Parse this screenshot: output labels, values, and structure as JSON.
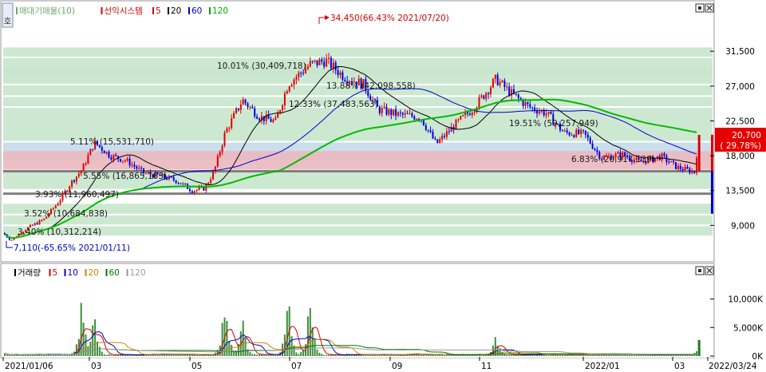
{
  "legend_price": {
    "items": [
      {
        "text": "매대기매물(10)",
        "color": "#6aa86a"
      },
      {
        "text": "선익시스템",
        "color": "#d40000"
      },
      {
        "text": "5",
        "color": "#d40000"
      },
      {
        "text": "20",
        "color": "#000000"
      },
      {
        "text": "60",
        "color": "#0000cc"
      },
      {
        "text": "120",
        "color": "#00aa00"
      }
    ]
  },
  "legend_volume": {
    "items": [
      {
        "text": "거래량",
        "color": "#000000"
      },
      {
        "text": "5",
        "color": "#d40000"
      },
      {
        "text": "10",
        "color": "#0000cc"
      },
      {
        "text": "20",
        "color": "#d08000"
      },
      {
        "text": "60",
        "color": "#007700"
      },
      {
        "text": "120",
        "color": "#999999"
      }
    ]
  },
  "annotations": {
    "high": "34,450(66.43% 2021/07/20)",
    "low": "7,110(-65.65% 2021/01/11)",
    "current_price": "20,700",
    "current_pct": "( 29.78%)"
  },
  "window_buttons": [
    "▣",
    "✕"
  ],
  "chart_data": [
    {
      "type": "candlestick",
      "y_axis": {
        "ticks": [
          "31,500",
          "27,000",
          "22,500",
          "18,000",
          "13,500",
          "9,000"
        ],
        "tick_values": [
          31500,
          27000,
          22500,
          18000,
          13500,
          9000
        ],
        "range": [
          4500,
          37500
        ]
      },
      "x_axis": {
        "ticks": [
          "2021/01/06",
          "03",
          "05",
          "07",
          "09",
          "11",
          "2022/01",
          "03",
          "2022/03/24"
        ]
      },
      "volume_profile_bands": [
        {
          "label": "3.40% (10,312,214)",
          "low": 7500,
          "high": 8900
        },
        {
          "label": "3.52% (10,684,838)",
          "low": 8900,
          "high": 10300
        },
        {
          "label": "3.93% (11,960,497)",
          "low": 10300,
          "high": 11800
        },
        {
          "label": "5.55% (16,865,163)",
          "low": 13500,
          "high": 16000
        },
        {
          "label": "5.11% (15,531,710)",
          "low": 17200,
          "high": 19700
        },
        {
          "label": "6.83% (20,917,139)",
          "low": 16000,
          "high": 18600
        },
        {
          "label": "19.51% (59,257,949)",
          "low": 19700,
          "high": 24200
        },
        {
          "label": "12.33% (37,483,563)",
          "low": 24200,
          "high": 25600
        },
        {
          "label": "13.88% (42,098,558)",
          "low": 25600,
          "high": 27100
        },
        {
          "label": "10.01% (30,409,718)",
          "low": 27100,
          "high": 30600
        },
        {
          "label": "",
          "low": 28300,
          "high": 29300
        },
        {
          "label": "",
          "low": 30600,
          "high": 32000
        }
      ],
      "horizontal_lines": [
        16000,
        13100
      ],
      "ohlc_close_path": [
        [
          "2021/01/06",
          8000
        ],
        [
          "2021/01/11",
          7110
        ],
        [
          "2021/01/20",
          8500
        ],
        [
          "2021/02/01",
          9800
        ],
        [
          "2021/02/10",
          12000
        ],
        [
          "2021/02/18",
          14500
        ],
        [
          "2021/02/25",
          16200
        ],
        [
          "2021/03/05",
          19700
        ],
        [
          "2021/03/15",
          18000
        ],
        [
          "2021/03/25",
          17400
        ],
        [
          "2021/04/05",
          15800
        ],
        [
          "2021/04/15",
          15400
        ],
        [
          "2021/04/26",
          14800
        ],
        [
          "2021/05/06",
          13500
        ],
        [
          "2021/05/14",
          13800
        ],
        [
          "2021/05/20",
          16000
        ],
        [
          "2021/05/27",
          21000
        ],
        [
          "2021/06/07",
          25200
        ],
        [
          "2021/06/18",
          23000
        ],
        [
          "2021/06/28",
          22400
        ],
        [
          "2021/07/06",
          27300
        ],
        [
          "2021/07/20",
          29800
        ],
        [
          "2021/07/30",
          30300
        ],
        [
          "2021/08/10",
          28300
        ],
        [
          "2021/08/23",
          27200
        ],
        [
          "2021/09/01",
          24000
        ],
        [
          "2021/09/14",
          23300
        ],
        [
          "2021/09/28",
          23000
        ],
        [
          "2021/10/08",
          19500
        ],
        [
          "2021/10/20",
          22000
        ],
        [
          "2021/11/01",
          24200
        ],
        [
          "2021/11/15",
          27900
        ],
        [
          "2021/11/25",
          26000
        ],
        [
          "2021/12/06",
          24300
        ],
        [
          "2021/12/17",
          23500
        ],
        [
          "2021/12/28",
          21000
        ],
        [
          "2022/01/10",
          20800
        ],
        [
          "2022/01/21",
          17700
        ],
        [
          "2022/02/03",
          18200
        ],
        [
          "2022/02/14",
          17200
        ],
        [
          "2022/02/28",
          17900
        ],
        [
          "2022/03/10",
          16500
        ],
        [
          "2022/03/21",
          15900
        ],
        [
          "2022/03/24",
          20700
        ]
      ],
      "moving_averages": [
        {
          "name": "20",
          "color": "#000000"
        },
        {
          "name": "60",
          "color": "#0000cc"
        },
        {
          "name": "120",
          "color": "#00bb00"
        }
      ]
    },
    {
      "type": "bar",
      "y_axis": {
        "ticks": [
          "10,000K",
          "5,000K",
          "0K"
        ],
        "tick_values": [
          10000,
          5000,
          0
        ]
      },
      "x_axis": {
        "ticks": [
          "2021/01/06",
          "03",
          "05",
          "07",
          "09",
          "11",
          "2022/01",
          "03",
          "2022/03/24"
        ]
      },
      "volume_spikes_k": [
        {
          "date": "2021/01/06",
          "value": 800
        },
        {
          "date": "2021/02/25",
          "value": 12000
        },
        {
          "date": "2021/03/05",
          "value": 9000
        },
        {
          "date": "2021/05/27",
          "value": 13500
        },
        {
          "date": "2021/06/07",
          "value": 7500
        },
        {
          "date": "2021/07/06",
          "value": 12000
        },
        {
          "date": "2021/07/20",
          "value": 13800
        },
        {
          "date": "2021/11/15",
          "value": 5000
        },
        {
          "date": "2022/03/24",
          "value": 2800
        }
      ]
    }
  ]
}
